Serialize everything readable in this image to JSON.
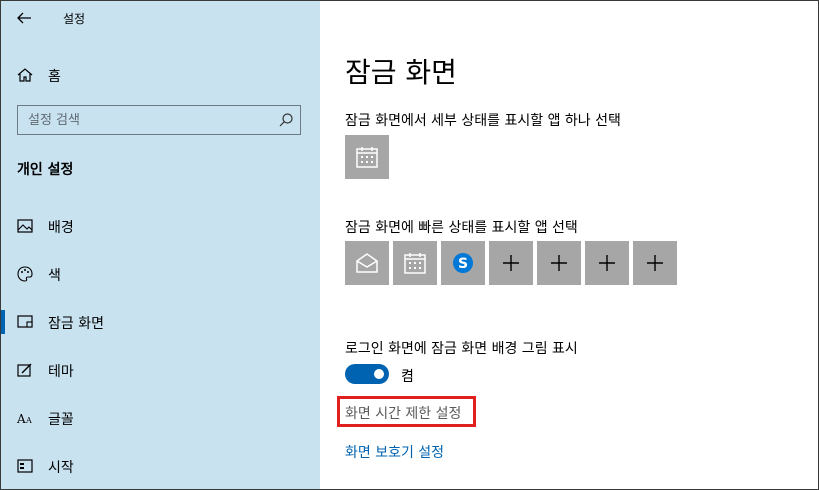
{
  "window": {
    "title": "설정"
  },
  "sidebar": {
    "home_label": "홈",
    "search": {
      "placeholder": "설정 검색"
    },
    "section_heading": "개인 설정",
    "items": [
      {
        "label": "배경",
        "icon": "image-icon"
      },
      {
        "label": "색",
        "icon": "palette-icon"
      },
      {
        "label": "잠금 화면",
        "icon": "lock-screen-icon",
        "selected": true
      },
      {
        "label": "테마",
        "icon": "theme-brush-icon"
      },
      {
        "label": "글꼴",
        "icon": "font-icon"
      },
      {
        "label": "시작",
        "icon": "start-icon"
      }
    ]
  },
  "main": {
    "title": "잠금 화면",
    "detailed_status_label": "잠금 화면에서 세부 상태를 표시할 앱 하나 선택",
    "detailed_status_app": "calendar-icon",
    "quick_status_label": "잠금 화면에 빠른 상태를 표시할 앱 선택",
    "quick_status_apps": [
      "mail-icon",
      "calendar-icon",
      "skype-icon",
      "plus-icon",
      "plus-icon",
      "plus-icon",
      "plus-icon"
    ],
    "signin_background_label": "로그인 화면에 잠금 화면 배경 그림 표시",
    "signin_background_toggle": {
      "state": "켬",
      "on": true
    },
    "screen_timeout_link": "화면 시간 제한 설정",
    "screensaver_link": "화면 보호기 설정"
  },
  "colors": {
    "sidebar_bg": "#c9e2f0",
    "accent": "#0063b1",
    "tile_bg": "#a6a6a6",
    "highlight": "#e0201e",
    "skype": "#0078d7"
  }
}
